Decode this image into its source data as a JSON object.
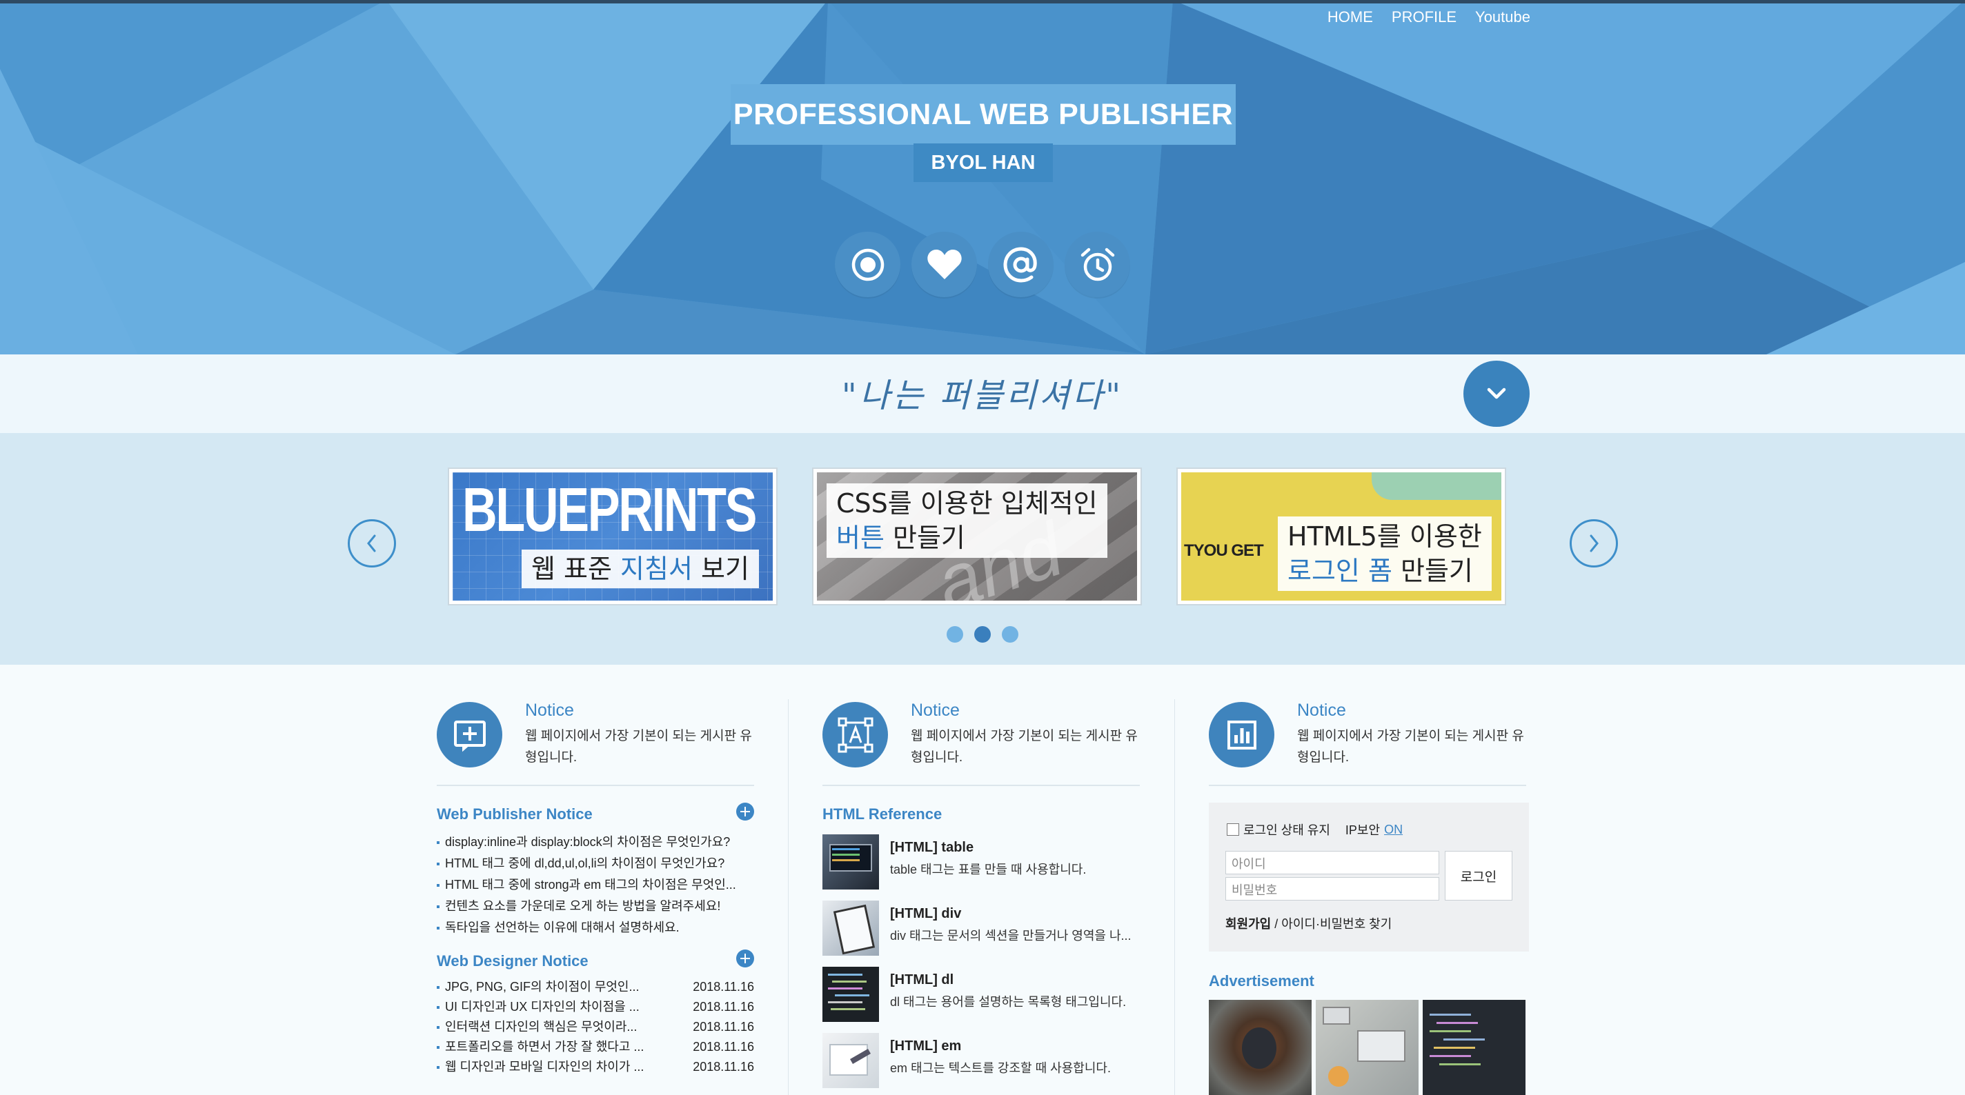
{
  "nav": {
    "home": "HOME",
    "profile": "PROFILE",
    "youtube": "Youtube"
  },
  "hero": {
    "title": "PROFESSIONAL WEB PUBLISHER",
    "subtitle": "BYOL HAN",
    "icons": [
      "record-icon",
      "heart-icon",
      "at-icon",
      "alarm-clock-icon"
    ]
  },
  "slogan": "\"나는 퍼블리셔다\"",
  "slider": {
    "slides": [
      {
        "big": "BLUEPRINTS",
        "caption_pre": "웹 표준 ",
        "caption_hl": "지침서",
        "caption_post": " 보기"
      },
      {
        "line1": "CSS를 이용한 입체적인",
        "line2_hl": "버튼",
        "line2_post": " 만들기",
        "ghost": "and inte"
      },
      {
        "side": "TYOU GET",
        "line1": "HTML5를 이용한",
        "line2_hl": "로그인 폼",
        "line2_post": " 만들기"
      }
    ],
    "active_dot": 1
  },
  "columns": [
    {
      "notice_title": "Notice",
      "notice_desc": "웹 페이지에서 가장 기본이 되는 게시판 유형입니다.",
      "icon": "add-square-icon"
    },
    {
      "notice_title": "Notice",
      "notice_desc": "웹 페이지에서 가장 기본이 되는 게시판 유형입니다.",
      "icon": "text-frame-icon"
    },
    {
      "notice_title": "Notice",
      "notice_desc": "웹 페이지에서 가장 기본이 되는 게시판 유형입니다.",
      "icon": "bar-chart-icon"
    }
  ],
  "publisher_notice": {
    "title": "Web Publisher Notice",
    "items": [
      "display:inline과 display:block의 차이점은 무엇인가요?",
      "HTML 태그 중에 dl,dd,ul,ol,li의 차이점이 무엇인가요?",
      "HTML 태그 중에 strong과 em 태그의 차이점은 무엇인...",
      "컨텐츠 요소를 가운데로 오게 하는 방법을 알려주세요!",
      "독타입을 선언하는 이유에 대해서 설명하세요."
    ]
  },
  "designer_notice": {
    "title": "Web Designer Notice",
    "items": [
      {
        "text": "JPG, PNG, GIF의 차이점이 무엇인...",
        "date": "2018.11.16"
      },
      {
        "text": "UI 디자인과 UX 디자인의 차이점을 ...",
        "date": "2018.11.16"
      },
      {
        "text": "인터랙션 디자인의 핵심은 무엇이라...",
        "date": "2018.11.16"
      },
      {
        "text": "포트폴리오를 하면서 가장 잘 했다고 ...",
        "date": "2018.11.16"
      },
      {
        "text": "웹 디자인과 모바일 디자인의 차이가 ...",
        "date": "2018.11.16"
      }
    ]
  },
  "html_reference": {
    "title": "HTML Reference",
    "items": [
      {
        "title": "[HTML] table",
        "desc": "table 태그는 표를 만들 때 사용합니다."
      },
      {
        "title": "[HTML] div",
        "desc": "div 태그는 문서의 섹션을 만들거나 영역을 나..."
      },
      {
        "title": "[HTML] dl",
        "desc": "dl 태그는 용어를 설명하는 목록형 태그입니다."
      },
      {
        "title": "[HTML] em",
        "desc": "em 태그는 텍스트를 강조할 때 사용합니다."
      }
    ]
  },
  "login": {
    "keep_label": "로그인 상태 유지",
    "ip_label": "IP보안",
    "ip_state": "ON",
    "id_placeholder": "아이디",
    "pw_placeholder": "비밀번호",
    "button": "로그인",
    "join": "회원가입",
    "separator": " / ",
    "find": "아이디·비밀번호 찾기"
  },
  "advertisement": {
    "title": "Advertisement"
  },
  "colors": {
    "brand": "#3c86c5",
    "hero": "#5ba6dc",
    "dark_blue": "#3a7fbd"
  }
}
